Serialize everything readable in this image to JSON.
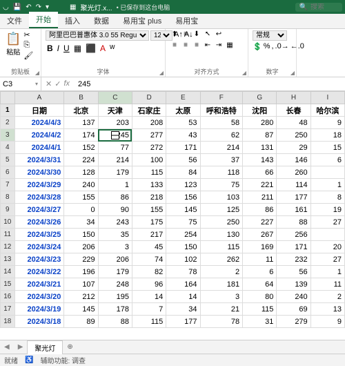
{
  "titlebar": {
    "filename": "聚光灯.x...",
    "save_status": "• 已保存到这台电脑",
    "search_placeholder": "搜索"
  },
  "tabs": [
    "文件",
    "开始",
    "插入",
    "数据",
    "易用宝 plus",
    "易用宝"
  ],
  "active_tab_index": 1,
  "ribbon": {
    "clipboard": {
      "label": "剪贴板",
      "paste": "粘贴"
    },
    "font": {
      "label": "字体",
      "name": "阿里巴巴普惠体 3.0 55 Regu",
      "size": "12"
    },
    "align": {
      "label": "对齐方式"
    },
    "number": {
      "label": "数字",
      "format": "常规"
    }
  },
  "cell": {
    "ref": "C3",
    "value": "245"
  },
  "columns": [
    "A",
    "B",
    "C",
    "D",
    "E",
    "F",
    "G",
    "H",
    "I"
  ],
  "header_row": [
    "日期",
    "北京",
    "天津",
    "石家庄",
    "太原",
    "呼和浩特",
    "沈阳",
    "长春",
    "哈尔滨"
  ],
  "rows": [
    {
      "n": 2,
      "d": "2024/4/3",
      "v": [
        137,
        203,
        208,
        53,
        58,
        280,
        48,
        "9"
      ]
    },
    {
      "n": 3,
      "d": "2024/4/2",
      "v": [
        174,
        245,
        277,
        43,
        62,
        87,
        250,
        "18"
      ]
    },
    {
      "n": 4,
      "d": "2024/4/1",
      "v": [
        152,
        77,
        272,
        171,
        214,
        131,
        29,
        "15"
      ]
    },
    {
      "n": 5,
      "d": "2024/3/31",
      "v": [
        224,
        214,
        100,
        56,
        37,
        143,
        146,
        "6"
      ]
    },
    {
      "n": 6,
      "d": "2024/3/30",
      "v": [
        128,
        179,
        115,
        84,
        118,
        66,
        260,
        ""
      ]
    },
    {
      "n": 7,
      "d": "2024/3/29",
      "v": [
        240,
        1,
        133,
        123,
        75,
        221,
        114,
        "1"
      ]
    },
    {
      "n": 8,
      "d": "2024/3/28",
      "v": [
        155,
        86,
        218,
        156,
        103,
        211,
        177,
        "8"
      ]
    },
    {
      "n": 9,
      "d": "2024/3/27",
      "v": [
        0,
        90,
        155,
        145,
        125,
        86,
        161,
        "19"
      ]
    },
    {
      "n": 10,
      "d": "2024/3/26",
      "v": [
        34,
        243,
        175,
        75,
        250,
        227,
        88,
        "27"
      ]
    },
    {
      "n": 11,
      "d": "2024/3/25",
      "v": [
        150,
        35,
        217,
        254,
        130,
        267,
        256,
        ""
      ]
    },
    {
      "n": 12,
      "d": "2024/3/24",
      "v": [
        206,
        3,
        45,
        150,
        115,
        169,
        171,
        "20"
      ]
    },
    {
      "n": 13,
      "d": "2024/3/23",
      "v": [
        229,
        206,
        74,
        102,
        262,
        11,
        232,
        "27"
      ]
    },
    {
      "n": 14,
      "d": "2024/3/22",
      "v": [
        196,
        179,
        82,
        78,
        2,
        6,
        56,
        "1"
      ]
    },
    {
      "n": 15,
      "d": "2024/3/21",
      "v": [
        107,
        248,
        96,
        164,
        181,
        64,
        139,
        "11"
      ]
    },
    {
      "n": 16,
      "d": "2024/3/20",
      "v": [
        212,
        195,
        14,
        14,
        3,
        80,
        240,
        "2"
      ]
    },
    {
      "n": 17,
      "d": "2024/3/19",
      "v": [
        145,
        178,
        7,
        34,
        21,
        115,
        69,
        "13"
      ]
    },
    {
      "n": 18,
      "d": "2024/3/18",
      "v": [
        89,
        88,
        115,
        177,
        78,
        31,
        279,
        "9"
      ]
    }
  ],
  "sheet": {
    "name": "聚光灯"
  },
  "status": {
    "ready": "就绪",
    "access": "辅助功能: 调查"
  }
}
